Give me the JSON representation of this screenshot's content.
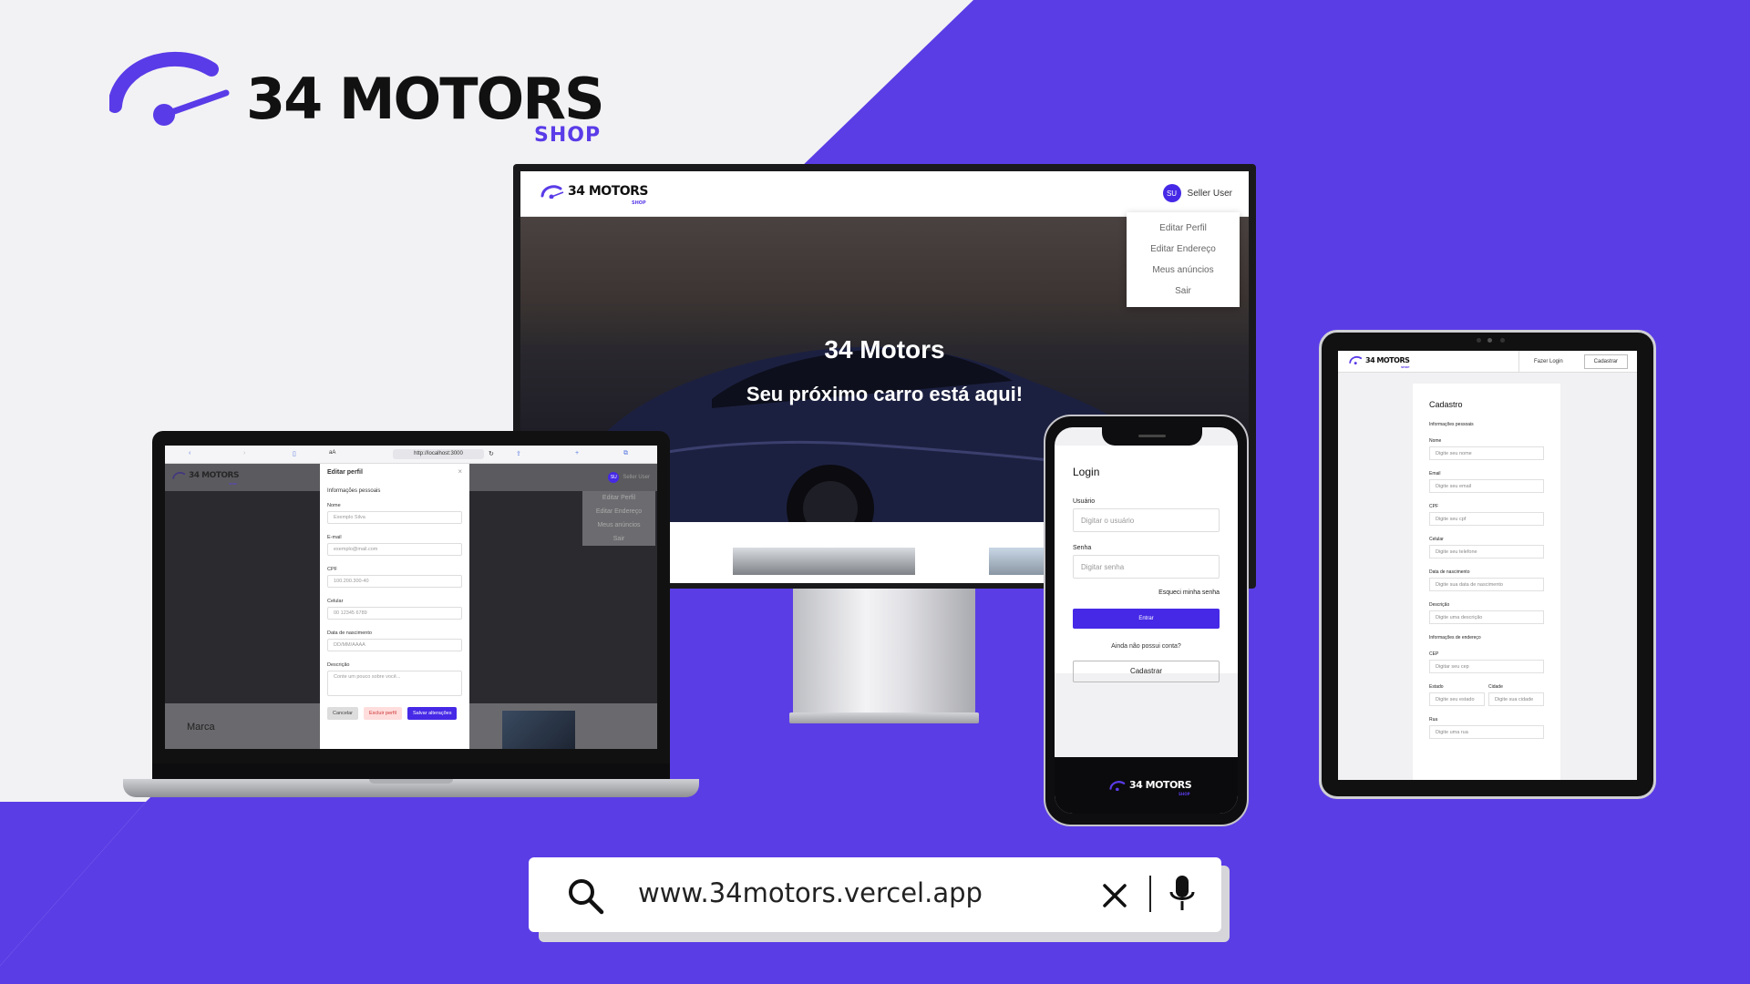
{
  "brand": {
    "name": "34 MOTORS",
    "sub": "SHOP",
    "accent": "#5a3be8"
  },
  "desktop": {
    "logo_text": "34 MOTORS",
    "logo_sub": "SHOP",
    "user_initials": "SU",
    "user_name": "Seller User",
    "menu": [
      "Editar Perfil",
      "Editar Endereço",
      "Meus anúncios",
      "Sair"
    ],
    "hero_title": "34 Motors",
    "hero_subtitle": "Seu próximo carro está aqui!"
  },
  "laptop": {
    "browser_tab": "aA",
    "browser_url": "http://localhost:3000",
    "logo_text": "34 MOTORS",
    "logo_sub": "SHOP",
    "user_initials": "SU",
    "user_name": "Seller User",
    "menu": [
      "Editar Perfil",
      "Editar Endereço",
      "Meus anúncios",
      "Sair"
    ],
    "footer_label": "Marca",
    "modal": {
      "title": "Editar perfil",
      "close": "×",
      "section": "Informações pessoais",
      "fields": [
        {
          "label": "Nome",
          "placeholder": "Exemplo Silva"
        },
        {
          "label": "E-mail",
          "placeholder": "exemplo@mail.com"
        },
        {
          "label": "CPF",
          "placeholder": "100.200.300-40"
        },
        {
          "label": "Celular",
          "placeholder": "00 12345 6789"
        },
        {
          "label": "Data de nascimento",
          "placeholder": "DD/MM/AAAA"
        }
      ],
      "desc_label": "Descrição",
      "desc_placeholder": "Conte um pouco sobre você...",
      "cancel": "Cancelar",
      "delete": "Excluir perfil",
      "save": "Salvar alterações"
    }
  },
  "phone": {
    "title": "Login",
    "user_label": "Usuário",
    "user_placeholder": "Digitar o usuário",
    "pass_label": "Senha",
    "pass_placeholder": "Digitar senha",
    "forgot": "Esqueci minha senha",
    "enter": "Entrar",
    "no_account": "Ainda não possui conta?",
    "register": "Cadastrar",
    "logo_text": "34 MOTORS",
    "logo_sub": "SHOP"
  },
  "tablet": {
    "logo_text": "34 MOTORS",
    "logo_sub": "SHOP",
    "login": "Fazer Login",
    "signup": "Cadastrar",
    "form_title": "Cadastro",
    "section_personal": "Informações pessoais",
    "fields": [
      {
        "label": "Nome",
        "placeholder": "Digite seu nome"
      },
      {
        "label": "Email",
        "placeholder": "Digite seu email"
      },
      {
        "label": "CPF",
        "placeholder": "Digite seu cpf"
      },
      {
        "label": "Celular",
        "placeholder": "Digite seu telefone"
      },
      {
        "label": "Data de nascimento",
        "placeholder": "Digite sua data de nascimento"
      },
      {
        "label": "Descrição",
        "placeholder": "Digite uma descrição"
      }
    ],
    "section_address": "Informações de endereço",
    "cep_label": "CEP",
    "cep_placeholder": "Digitar seu cep",
    "state_label": "Estado",
    "state_placeholder": "Digite seu estado",
    "city_label": "Cidade",
    "city_placeholder": "Digite sua cidade",
    "street_label": "Rua",
    "street_placeholder": "Digite uma rua"
  },
  "search": {
    "url": "www.34motors.vercel.app",
    "icons": [
      "search-icon",
      "close-icon",
      "mic-icon"
    ]
  },
  "colors": {
    "purple": "#5b3de6",
    "button": "#4529e6",
    "bg": "#f2f2f4"
  }
}
